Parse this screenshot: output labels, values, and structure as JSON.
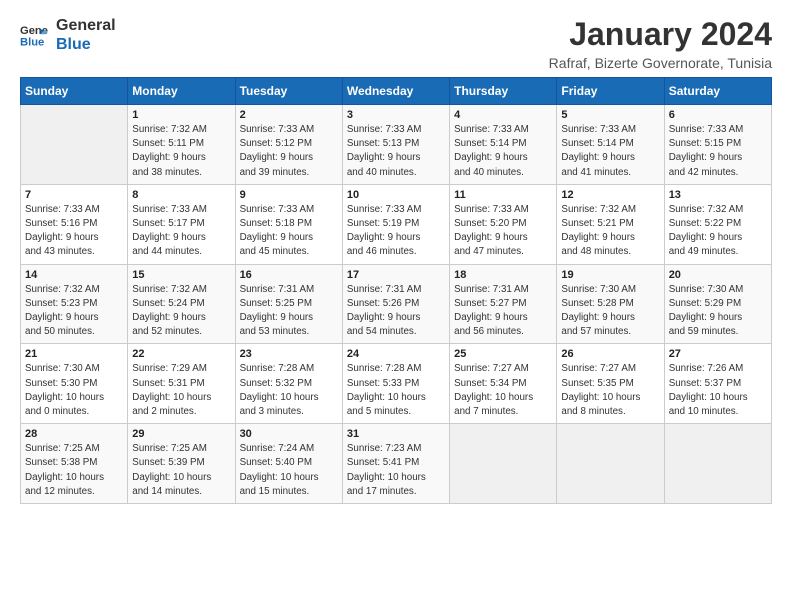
{
  "logo": {
    "line1": "General",
    "line2": "Blue"
  },
  "title": "January 2024",
  "subtitle": "Rafraf, Bizerte Governorate, Tunisia",
  "headers": [
    "Sunday",
    "Monday",
    "Tuesday",
    "Wednesday",
    "Thursday",
    "Friday",
    "Saturday"
  ],
  "weeks": [
    [
      {
        "num": "",
        "lines": []
      },
      {
        "num": "1",
        "lines": [
          "Sunrise: 7:32 AM",
          "Sunset: 5:11 PM",
          "Daylight: 9 hours",
          "and 38 minutes."
        ]
      },
      {
        "num": "2",
        "lines": [
          "Sunrise: 7:33 AM",
          "Sunset: 5:12 PM",
          "Daylight: 9 hours",
          "and 39 minutes."
        ]
      },
      {
        "num": "3",
        "lines": [
          "Sunrise: 7:33 AM",
          "Sunset: 5:13 PM",
          "Daylight: 9 hours",
          "and 40 minutes."
        ]
      },
      {
        "num": "4",
        "lines": [
          "Sunrise: 7:33 AM",
          "Sunset: 5:14 PM",
          "Daylight: 9 hours",
          "and 40 minutes."
        ]
      },
      {
        "num": "5",
        "lines": [
          "Sunrise: 7:33 AM",
          "Sunset: 5:14 PM",
          "Daylight: 9 hours",
          "and 41 minutes."
        ]
      },
      {
        "num": "6",
        "lines": [
          "Sunrise: 7:33 AM",
          "Sunset: 5:15 PM",
          "Daylight: 9 hours",
          "and 42 minutes."
        ]
      }
    ],
    [
      {
        "num": "7",
        "lines": [
          "Sunrise: 7:33 AM",
          "Sunset: 5:16 PM",
          "Daylight: 9 hours",
          "and 43 minutes."
        ]
      },
      {
        "num": "8",
        "lines": [
          "Sunrise: 7:33 AM",
          "Sunset: 5:17 PM",
          "Daylight: 9 hours",
          "and 44 minutes."
        ]
      },
      {
        "num": "9",
        "lines": [
          "Sunrise: 7:33 AM",
          "Sunset: 5:18 PM",
          "Daylight: 9 hours",
          "and 45 minutes."
        ]
      },
      {
        "num": "10",
        "lines": [
          "Sunrise: 7:33 AM",
          "Sunset: 5:19 PM",
          "Daylight: 9 hours",
          "and 46 minutes."
        ]
      },
      {
        "num": "11",
        "lines": [
          "Sunrise: 7:33 AM",
          "Sunset: 5:20 PM",
          "Daylight: 9 hours",
          "and 47 minutes."
        ]
      },
      {
        "num": "12",
        "lines": [
          "Sunrise: 7:32 AM",
          "Sunset: 5:21 PM",
          "Daylight: 9 hours",
          "and 48 minutes."
        ]
      },
      {
        "num": "13",
        "lines": [
          "Sunrise: 7:32 AM",
          "Sunset: 5:22 PM",
          "Daylight: 9 hours",
          "and 49 minutes."
        ]
      }
    ],
    [
      {
        "num": "14",
        "lines": [
          "Sunrise: 7:32 AM",
          "Sunset: 5:23 PM",
          "Daylight: 9 hours",
          "and 50 minutes."
        ]
      },
      {
        "num": "15",
        "lines": [
          "Sunrise: 7:32 AM",
          "Sunset: 5:24 PM",
          "Daylight: 9 hours",
          "and 52 minutes."
        ]
      },
      {
        "num": "16",
        "lines": [
          "Sunrise: 7:31 AM",
          "Sunset: 5:25 PM",
          "Daylight: 9 hours",
          "and 53 minutes."
        ]
      },
      {
        "num": "17",
        "lines": [
          "Sunrise: 7:31 AM",
          "Sunset: 5:26 PM",
          "Daylight: 9 hours",
          "and 54 minutes."
        ]
      },
      {
        "num": "18",
        "lines": [
          "Sunrise: 7:31 AM",
          "Sunset: 5:27 PM",
          "Daylight: 9 hours",
          "and 56 minutes."
        ]
      },
      {
        "num": "19",
        "lines": [
          "Sunrise: 7:30 AM",
          "Sunset: 5:28 PM",
          "Daylight: 9 hours",
          "and 57 minutes."
        ]
      },
      {
        "num": "20",
        "lines": [
          "Sunrise: 7:30 AM",
          "Sunset: 5:29 PM",
          "Daylight: 9 hours",
          "and 59 minutes."
        ]
      }
    ],
    [
      {
        "num": "21",
        "lines": [
          "Sunrise: 7:30 AM",
          "Sunset: 5:30 PM",
          "Daylight: 10 hours",
          "and 0 minutes."
        ]
      },
      {
        "num": "22",
        "lines": [
          "Sunrise: 7:29 AM",
          "Sunset: 5:31 PM",
          "Daylight: 10 hours",
          "and 2 minutes."
        ]
      },
      {
        "num": "23",
        "lines": [
          "Sunrise: 7:28 AM",
          "Sunset: 5:32 PM",
          "Daylight: 10 hours",
          "and 3 minutes."
        ]
      },
      {
        "num": "24",
        "lines": [
          "Sunrise: 7:28 AM",
          "Sunset: 5:33 PM",
          "Daylight: 10 hours",
          "and 5 minutes."
        ]
      },
      {
        "num": "25",
        "lines": [
          "Sunrise: 7:27 AM",
          "Sunset: 5:34 PM",
          "Daylight: 10 hours",
          "and 7 minutes."
        ]
      },
      {
        "num": "26",
        "lines": [
          "Sunrise: 7:27 AM",
          "Sunset: 5:35 PM",
          "Daylight: 10 hours",
          "and 8 minutes."
        ]
      },
      {
        "num": "27",
        "lines": [
          "Sunrise: 7:26 AM",
          "Sunset: 5:37 PM",
          "Daylight: 10 hours",
          "and 10 minutes."
        ]
      }
    ],
    [
      {
        "num": "28",
        "lines": [
          "Sunrise: 7:25 AM",
          "Sunset: 5:38 PM",
          "Daylight: 10 hours",
          "and 12 minutes."
        ]
      },
      {
        "num": "29",
        "lines": [
          "Sunrise: 7:25 AM",
          "Sunset: 5:39 PM",
          "Daylight: 10 hours",
          "and 14 minutes."
        ]
      },
      {
        "num": "30",
        "lines": [
          "Sunrise: 7:24 AM",
          "Sunset: 5:40 PM",
          "Daylight: 10 hours",
          "and 15 minutes."
        ]
      },
      {
        "num": "31",
        "lines": [
          "Sunrise: 7:23 AM",
          "Sunset: 5:41 PM",
          "Daylight: 10 hours",
          "and 17 minutes."
        ]
      },
      {
        "num": "",
        "lines": []
      },
      {
        "num": "",
        "lines": []
      },
      {
        "num": "",
        "lines": []
      }
    ]
  ]
}
